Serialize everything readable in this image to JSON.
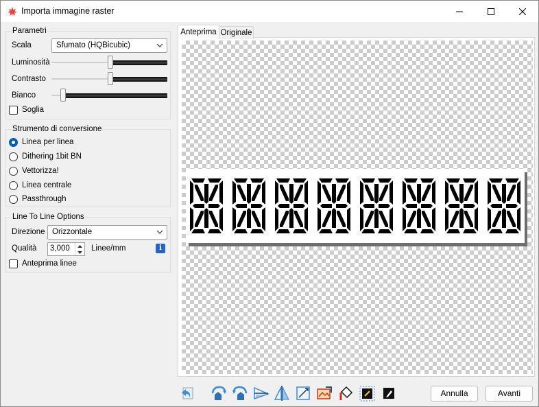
{
  "window": {
    "title": "Importa immagine raster",
    "controls": {
      "minimize": "minimize",
      "maximize": "maximize",
      "close": "close"
    }
  },
  "parametri": {
    "title": "Parametri",
    "scala_label": "Scala",
    "scala_value": "Sfumato (HQBicubic)",
    "luminosita_label": "Luminosità",
    "luminosita_level": 0.5,
    "contrasto_label": "Contrasto",
    "contrasto_level": 0.5,
    "bianco_label": "Bianco",
    "bianco_level": 0.07,
    "soglia_label": "Soglia",
    "soglia_checked": false
  },
  "strumento": {
    "title": "Strumento di conversione",
    "options": [
      {
        "label": "Linea per linea",
        "checked": true
      },
      {
        "label": "Dithering 1bit BN",
        "checked": false
      },
      {
        "label": "Vettorizza!",
        "checked": false
      },
      {
        "label": "Linea centrale",
        "checked": false
      },
      {
        "label": "Passthrough",
        "checked": false
      }
    ]
  },
  "line_options": {
    "title": "Line To Line Options",
    "direzione_label": "Direzione",
    "direzione_value": "Orizzontale",
    "qualita_label": "Qualità",
    "qualita_value": "3,000",
    "qualita_unit": "Linee/mm",
    "info_icon": "info-icon",
    "anteprima_linee_label": "Anteprima linee",
    "anteprima_linee_checked": false
  },
  "tabs": [
    {
      "label": "Anteprima",
      "active": true
    },
    {
      "label": "Originale",
      "active": false
    }
  ],
  "preview": {
    "digit_count": 8
  },
  "toolbar": {
    "icons": [
      "reset-icon",
      "rotate-ccw-icon",
      "rotate-cw-icon",
      "flip-horizontal-icon",
      "flip-vertical-icon",
      "crop-icon",
      "auto-crop-icon",
      "fill-icon",
      "invert-icon",
      "edit-icon"
    ]
  },
  "buttons": {
    "cancel": "Annulla",
    "next": "Avanti"
  },
  "colors": {
    "accent": "#005fb8",
    "info": "#2563c9",
    "segment": "#000000"
  }
}
